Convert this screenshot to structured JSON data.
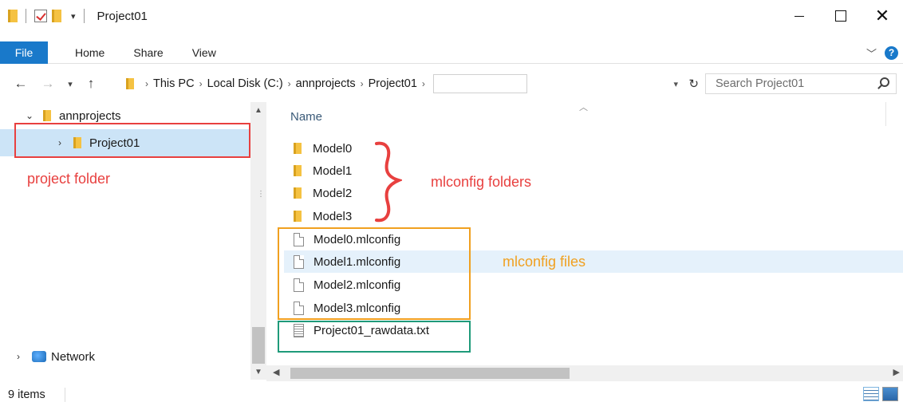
{
  "window": {
    "title": "Project01"
  },
  "ribbon": {
    "tabs": [
      "File",
      "Home",
      "Share",
      "View"
    ],
    "help": "?"
  },
  "address": {
    "crumbs": [
      "This PC",
      "Local Disk (C:)",
      "annprojects",
      "Project01"
    ]
  },
  "search": {
    "placeholder": "Search Project01"
  },
  "nav": {
    "items": [
      {
        "label": "annprojects"
      },
      {
        "label": "Project01"
      },
      {
        "label": "Network"
      }
    ]
  },
  "filelist": {
    "column": "Name",
    "folders": [
      "Model0",
      "Model1",
      "Model2",
      "Model3"
    ],
    "configs": [
      "Model0.mlconfig",
      "Model1.mlconfig",
      "Model2.mlconfig",
      "Model3.mlconfig"
    ],
    "text_file": "Project01_rawdata.txt"
  },
  "status": {
    "count": "9 items"
  },
  "annotations": {
    "project_folder": "project folder",
    "mlconfig_folders": "mlconfig folders",
    "mlconfig_files": "mlconfig files",
    "colors": {
      "red": "#e8403f",
      "orange": "#f0a020",
      "green": "#1f9a7a"
    }
  }
}
